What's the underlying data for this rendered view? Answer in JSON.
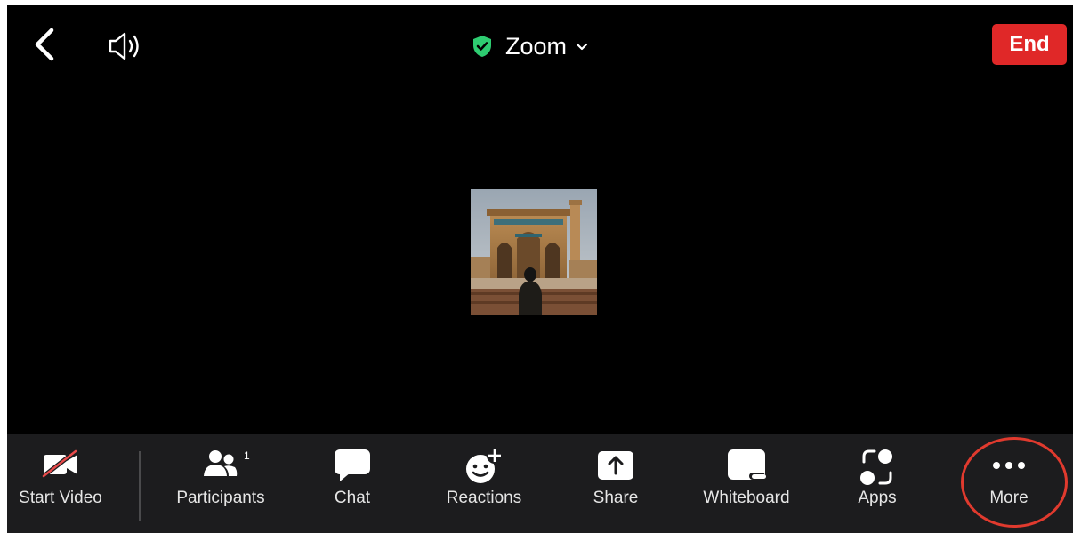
{
  "header": {
    "title": "Zoom",
    "end_label": "End",
    "icons": [
      "back-chevron-icon",
      "speaker-icon",
      "shield-check-icon",
      "chevron-down-icon"
    ]
  },
  "colors": {
    "background": "#000000",
    "toolbar": "#1c1c1e",
    "end_button": "#e02828",
    "shield": "#2ecc71",
    "highlight_ring": "#e03a2e",
    "muted_slash": "#e84a4a"
  },
  "toolbar": {
    "start_video": "Start Video",
    "participants": "Participants",
    "participants_count": "1",
    "chat": "Chat",
    "reactions": "Reactions",
    "share": "Share",
    "whiteboard": "Whiteboard",
    "apps": "Apps",
    "more": "More"
  }
}
